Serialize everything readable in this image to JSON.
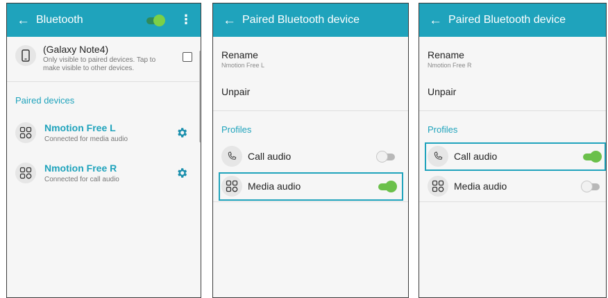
{
  "panel1": {
    "title": "Bluetooth",
    "bt_enabled": true,
    "this_device": {
      "name": "(Galaxy Note4)",
      "desc_line1": "Only visible to paired devices. Tap to",
      "desc_line2": "make visible to other devices.",
      "visible_checked": false
    },
    "paired_header": "Paired devices",
    "paired": [
      {
        "name": "Nmotion Free L",
        "status": "Connected for media audio"
      },
      {
        "name": "Nmotion Free R",
        "status": "Connected for call audio"
      }
    ]
  },
  "panel2": {
    "title": "Paired Bluetooth device",
    "rename_label": "Rename",
    "device_name": "Nmotion Free L",
    "unpair_label": "Unpair",
    "profiles_header": "Profiles",
    "profiles": [
      {
        "label": "Call audio",
        "enabled": false
      },
      {
        "label": "Media audio",
        "enabled": true
      }
    ]
  },
  "panel3": {
    "title": "Paired Bluetooth device",
    "rename_label": "Rename",
    "device_name": "Nmotion Free R",
    "unpair_label": "Unpair",
    "profiles_header": "Profiles",
    "profiles": [
      {
        "label": "Call audio",
        "enabled": true
      },
      {
        "label": "Media audio",
        "enabled": false
      }
    ]
  },
  "colors": {
    "accent": "#1fa3bc",
    "toggle_on": "#6bc04b",
    "highlight": "#1fa3bc"
  },
  "icons": {
    "back": "arrow-left-icon",
    "more": "more-vert-icon",
    "phone": "phone-icon",
    "headset": "bluetooth-device-icon",
    "gear": "gear-icon",
    "call": "call-icon"
  }
}
